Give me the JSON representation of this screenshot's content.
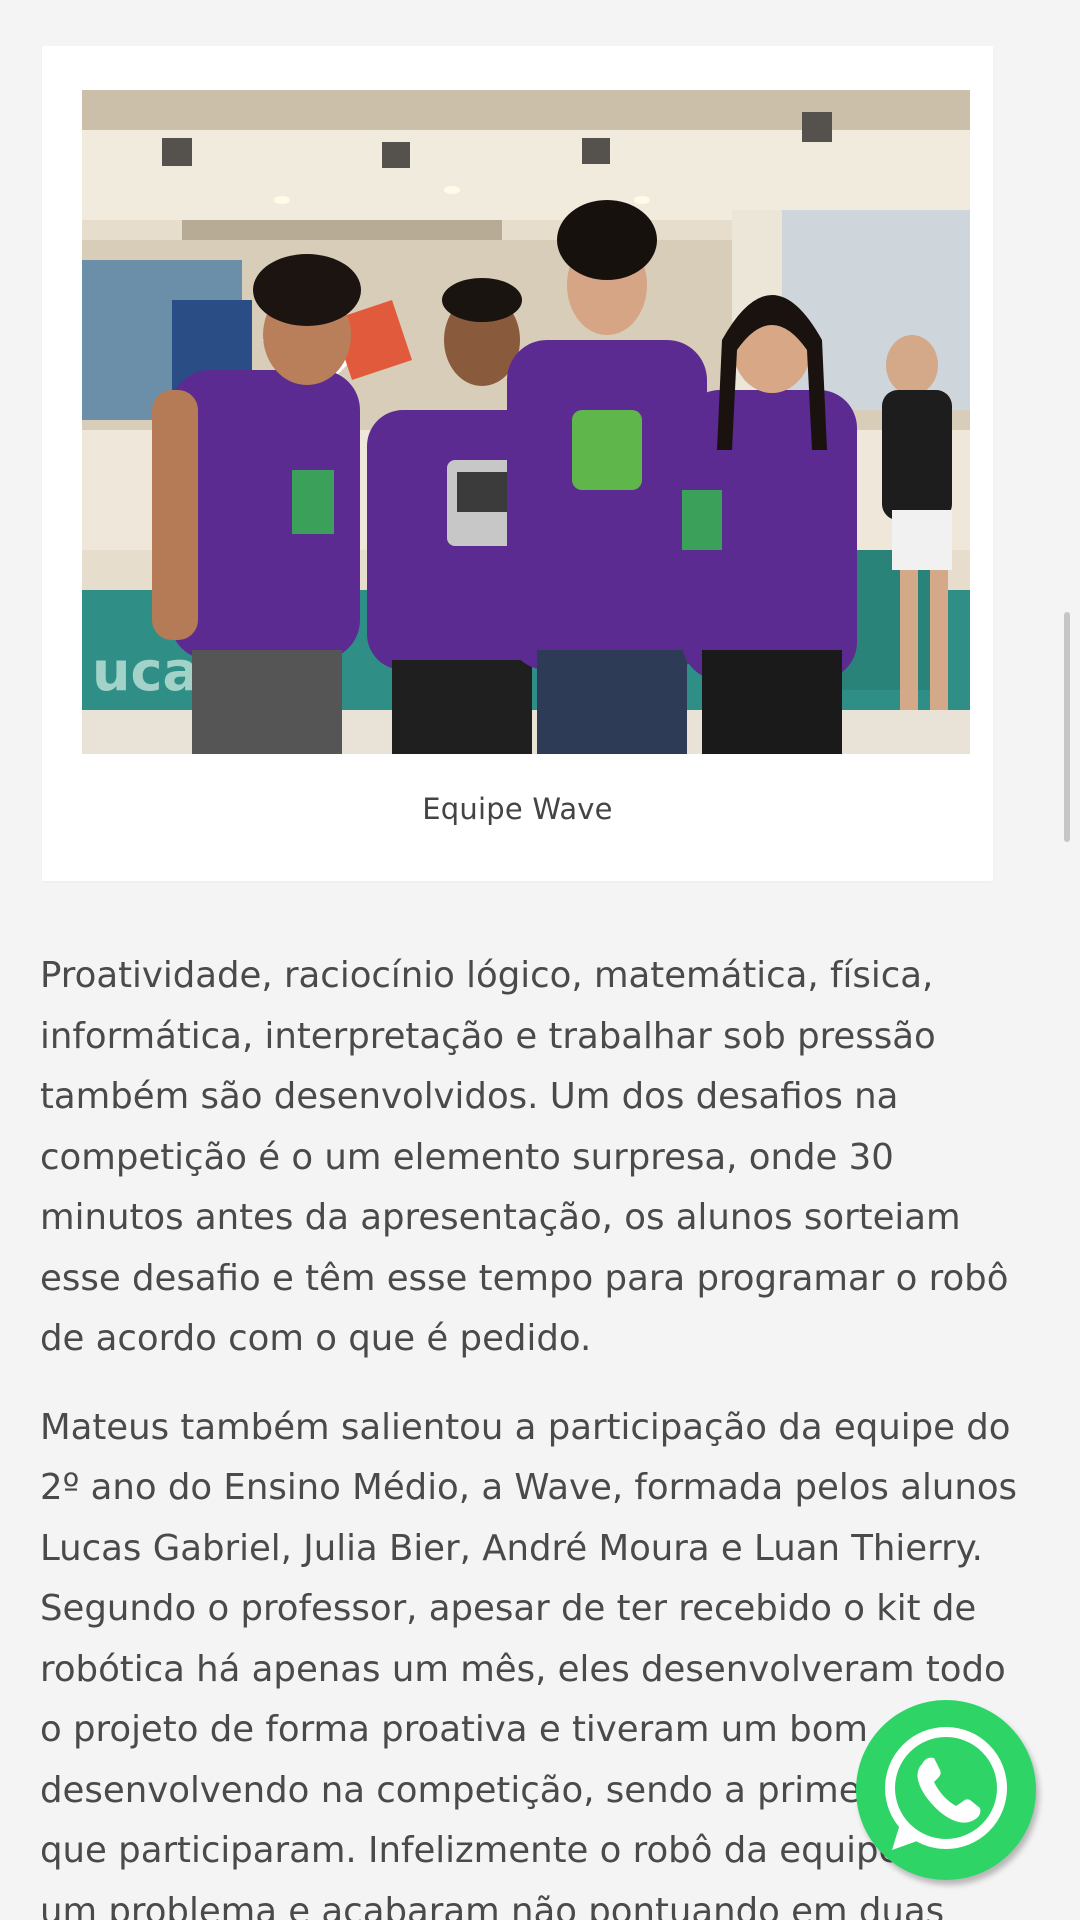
{
  "figure": {
    "image_alt": "Equipe Wave",
    "caption": "Equipe Wave"
  },
  "article": {
    "paragraphs": [
      "Proatividade, raciocínio lógico, matemática, física, informática, interpretação e trabalhar sob pressão também são desenvolvidos. Um dos desafios na competição é o um elemento surpresa, onde 30 minutos antes da apresentação, os alunos sorteiam esse desafio e têm esse tempo para programar o robô de acordo com o que é pedido.",
      "Mateus também salientou a participação da equipe do 2º ano do Ensino Médio, a Wave, formada pelos alunos Lucas Gabriel, Julia Bier, André Moura e Luan Thierry. Segundo o professor, apesar de ter recebido o kit de robótica há apenas um mês, eles desenvolveram todo o projeto de forma proativa e tiveram um bom desenvolvendo na competição, sendo a primeira vez que participaram. Infelizmente o robô da equipe teve um problema e acabaram não pontuando em duas"
    ]
  },
  "floating": {
    "whatsapp_icon": "whatsapp-icon",
    "color": "#2fd467"
  },
  "colors": {
    "background": "#f4f4f4",
    "text": "#4a4a4a",
    "shirt": "#5b2b91"
  }
}
